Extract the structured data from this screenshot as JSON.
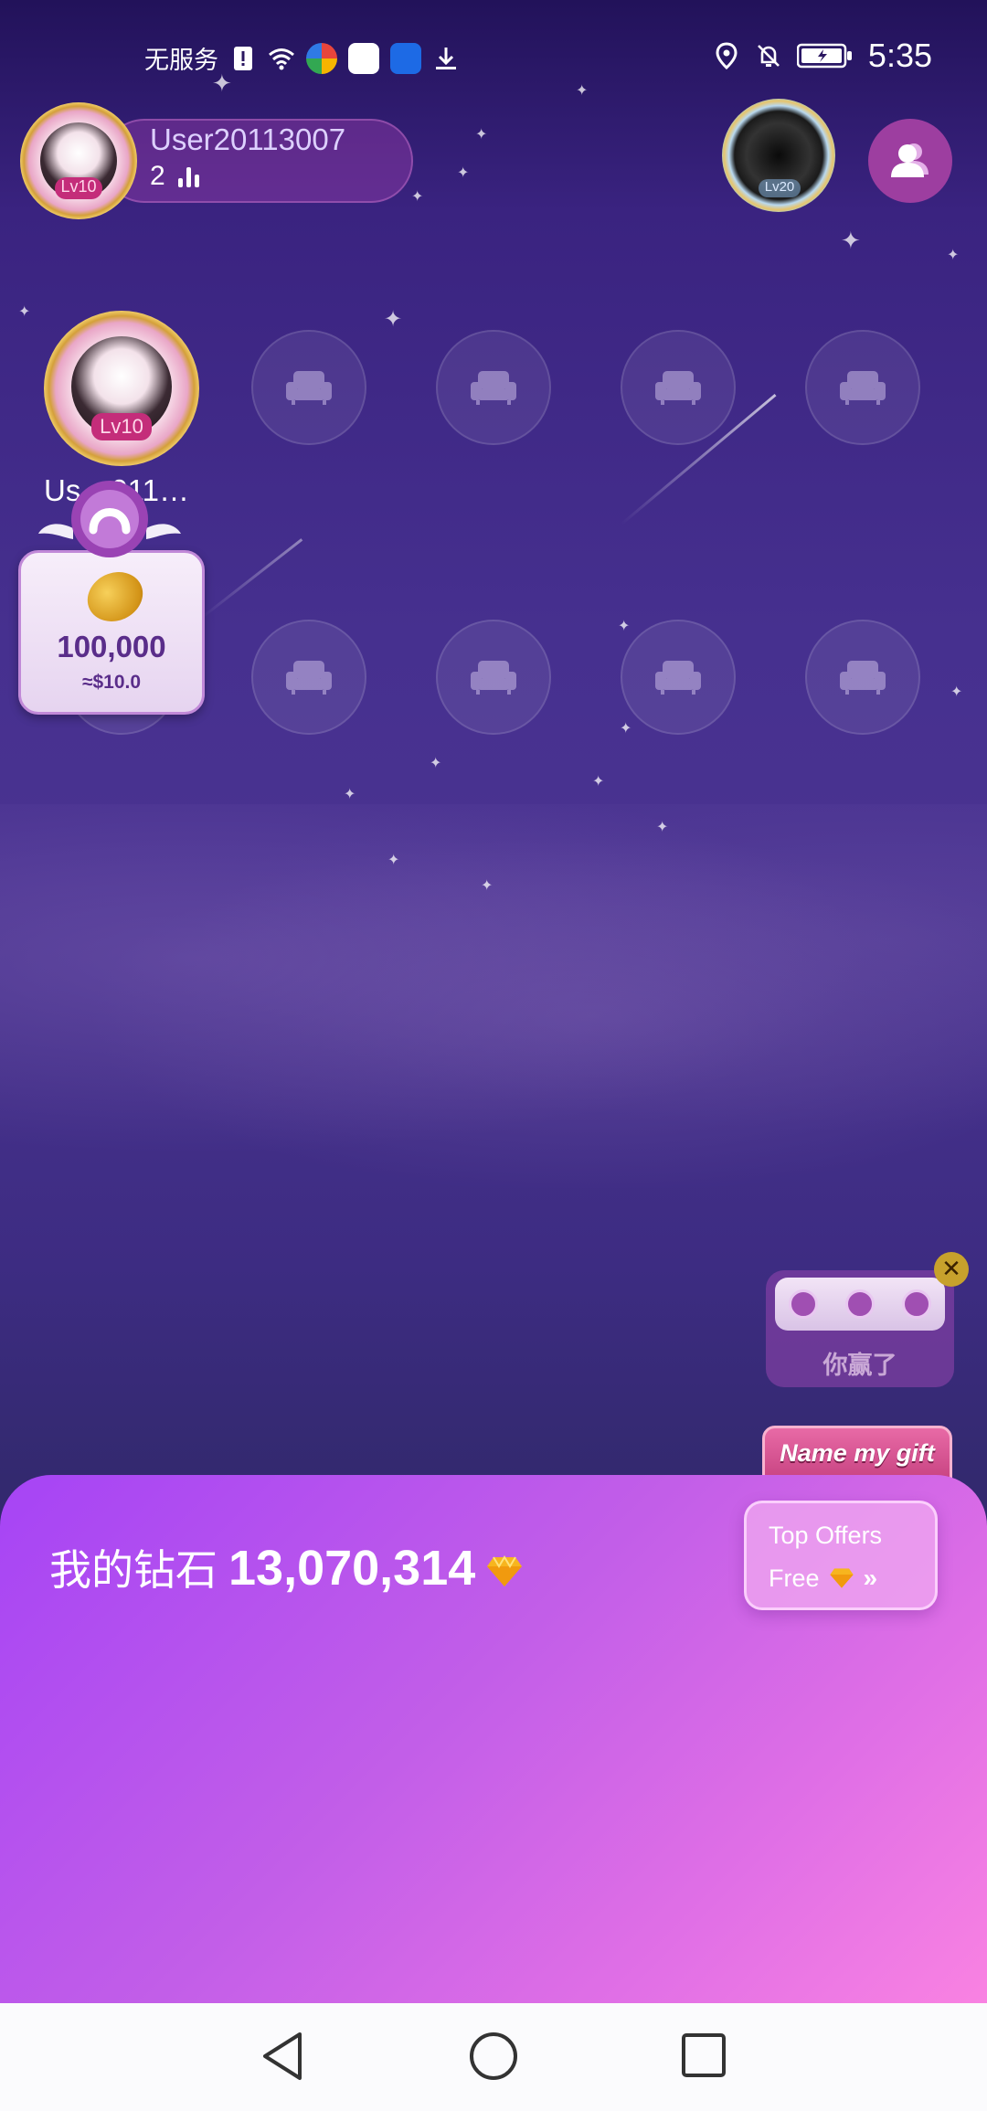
{
  "status_bar": {
    "carrier": "无服务",
    "time": "5:35"
  },
  "owner": {
    "name": "User20113007",
    "count": "2",
    "level": "Lv10"
  },
  "top_right": {
    "level": "Lv20"
  },
  "host": {
    "name": "Us…011…",
    "level": "Lv10"
  },
  "gift_card": {
    "amount": "100,000",
    "usd": "≈$10.0"
  },
  "you_won": {
    "text": "你赢了"
  },
  "name_gift": {
    "text": "Name my gift"
  },
  "sheet": {
    "diamond_label": "我的钻石",
    "diamond_value": "13,070,314",
    "top_offers_line1": "Top Offers",
    "top_offers_line2": "Free"
  },
  "colors": {
    "sheet_start": "#a644f5",
    "sheet_end": "#f982e2",
    "background_top": "#22125a",
    "background_bottom": "#2e2668"
  }
}
